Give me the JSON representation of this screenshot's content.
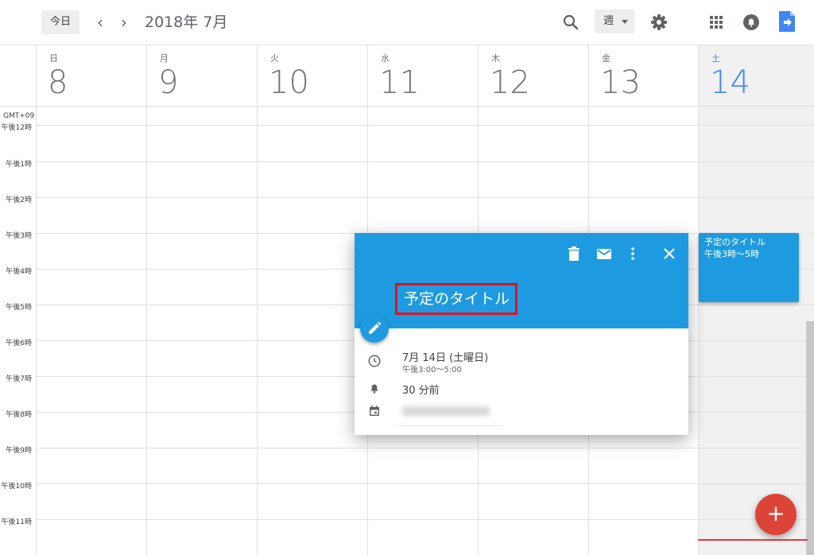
{
  "header": {
    "today_label": "今日",
    "prev_label": "‹",
    "next_label": "›",
    "month_title": "2018年 7月",
    "view_label": "週",
    "icons": [
      "search-icon",
      "gear-icon",
      "apps-grid-icon",
      "notifications-icon",
      "extension-icon"
    ]
  },
  "timezone": "GMT+09",
  "days": [
    {
      "dow": "日",
      "num": "8"
    },
    {
      "dow": "月",
      "num": "9"
    },
    {
      "dow": "火",
      "num": "10"
    },
    {
      "dow": "水",
      "num": "11"
    },
    {
      "dow": "木",
      "num": "12"
    },
    {
      "dow": "金",
      "num": "13"
    },
    {
      "dow": "土",
      "num": "14"
    }
  ],
  "time_labels": [
    "午後12時",
    "午後1時",
    "午後2時",
    "午後3時",
    "午後4時",
    "午後5時",
    "午後6時",
    "午後7時",
    "午後8時",
    "午後9時",
    "午後10時",
    "午後11時"
  ],
  "event": {
    "title": "予定のタイトル",
    "time": "午後3時～5時"
  },
  "popup": {
    "title": "予定のタイトル",
    "date": "7月 14日 (土曜日)",
    "time_range": "午後3:00～5:00",
    "reminder": "30 分前",
    "icons": [
      "trash-icon",
      "mail-icon",
      "more-vert-icon",
      "close-icon",
      "pencil-icon",
      "clock-icon",
      "bell-icon",
      "calendar-icon"
    ]
  },
  "fab": {
    "label": "+"
  },
  "colors": {
    "event_blue": "#1e9be0",
    "today_blue": "#4285f4",
    "fab_red": "#db4437",
    "highlight_red": "#e01020",
    "now_line": "#e53935"
  }
}
